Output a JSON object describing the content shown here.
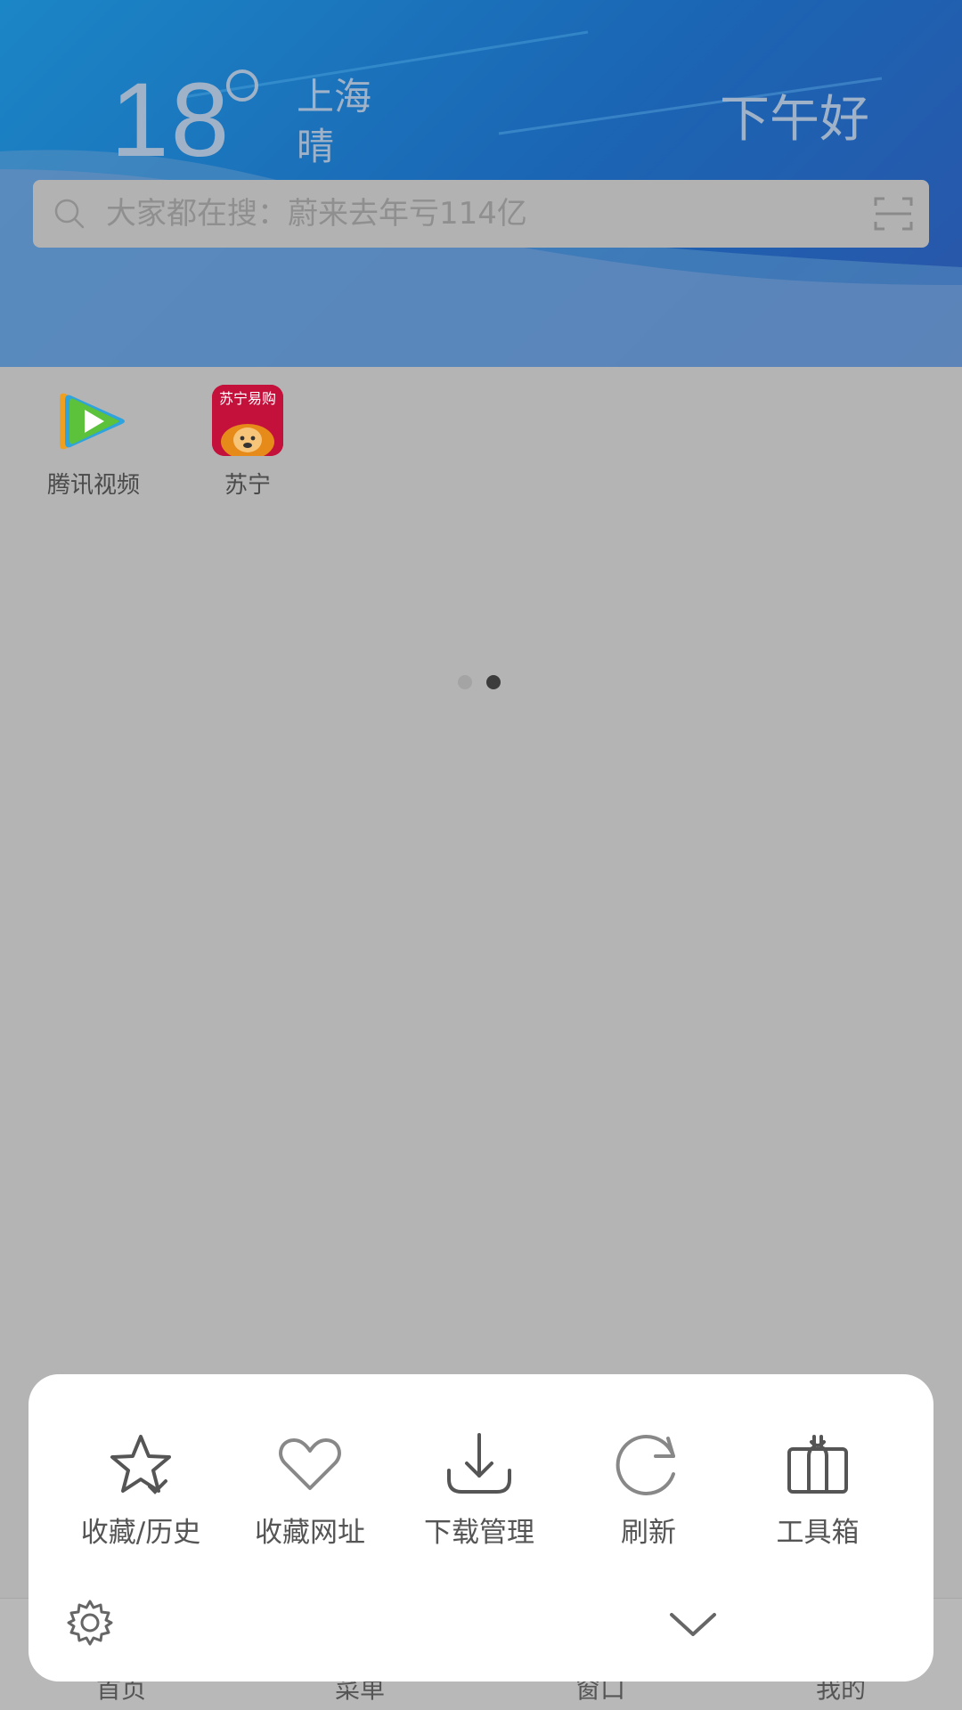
{
  "weather": {
    "temperature": "18",
    "city": "上海",
    "condition": "晴"
  },
  "greeting": "下午好",
  "search": {
    "placeholder": "大家都在搜：蔚来去年亏114亿"
  },
  "shortcuts": [
    {
      "label": "腾讯视频",
      "icon": "tencent-video-icon"
    },
    {
      "label": "苏宁",
      "icon": "suning-icon",
      "icon_text": "苏宁易购"
    }
  ],
  "pager": {
    "total": 2,
    "active": 2
  },
  "bottom_nav": {
    "items": [
      "首页",
      "菜单",
      "窗口",
      "我的"
    ]
  },
  "menu": {
    "items": [
      {
        "label": "收藏/历史",
        "icon": "star-check-icon"
      },
      {
        "label": "收藏网址",
        "icon": "heart-icon"
      },
      {
        "label": "下载管理",
        "icon": "download-icon"
      },
      {
        "label": "刷新",
        "icon": "refresh-icon"
      },
      {
        "label": "工具箱",
        "icon": "toolbox-icon"
      }
    ],
    "settings_icon": "gear-icon",
    "collapse_icon": "chevron-down-icon"
  },
  "colors": {
    "header_start": "#1b86c6",
    "header_end": "#2a55a8",
    "overlay": "#b4b4b4",
    "menu_bg": "#ffffff",
    "menu_text": "#555555"
  }
}
